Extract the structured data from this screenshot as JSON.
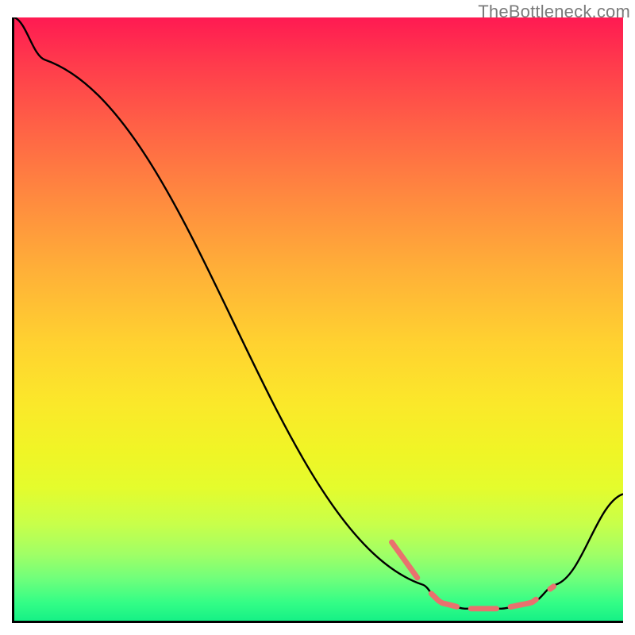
{
  "watermark": "TheBottleneck.com",
  "chart_data": {
    "type": "line",
    "title": "",
    "xlabel": "",
    "ylabel": "",
    "ylim": [
      0,
      100
    ],
    "xlim": [
      0,
      100
    ],
    "curve": {
      "name": "bottleneck-curve",
      "points": [
        {
          "x": 0,
          "y": 100
        },
        {
          "x": 5,
          "y": 93
        },
        {
          "x": 67,
          "y": 6
        },
        {
          "x": 70,
          "y": 3
        },
        {
          "x": 74,
          "y": 2
        },
        {
          "x": 80,
          "y": 2
        },
        {
          "x": 85,
          "y": 3
        },
        {
          "x": 89,
          "y": 6
        },
        {
          "x": 100,
          "y": 21
        }
      ]
    },
    "highlight_segment": {
      "name": "optimal-range",
      "color": "#e9716e",
      "xrange": [
        62,
        89
      ]
    },
    "gradient": {
      "name": "severity-gradient",
      "top_color": "#ff1a52",
      "bottom_color": "#16f186"
    }
  }
}
